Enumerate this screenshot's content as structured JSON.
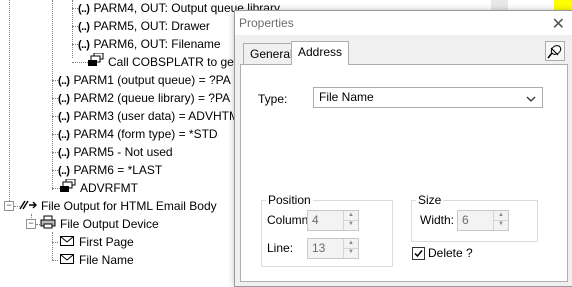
{
  "tree": {
    "rows": [
      {
        "kind": "param",
        "text": "PARM4, OUT: Output queue library"
      },
      {
        "kind": "param",
        "text": "PARM5, OUT: Drawer"
      },
      {
        "kind": "param",
        "text": "PARM6, OUT: Filename"
      },
      {
        "kind": "call",
        "text": "Call COBSPLATR to get qu"
      },
      {
        "kind": "param",
        "text": "PARM1 (output queue) =  ?PA"
      },
      {
        "kind": "param",
        "text": "PARM2 (queue library) =  ?PA"
      },
      {
        "kind": "param",
        "text": "PARM3 (user data) = ADVHTM"
      },
      {
        "kind": "param",
        "text": "PARM4 (form type) = *STD"
      },
      {
        "kind": "param",
        "text": "PARM5 - Not used"
      },
      {
        "kind": "param",
        "text": "PARM6 = *LAST"
      },
      {
        "kind": "call",
        "text": "ADVRFMT"
      },
      {
        "kind": "output",
        "text": "File Output for HTML Email Body"
      },
      {
        "kind": "device",
        "text": "File Output Device"
      },
      {
        "kind": "mail",
        "text": "First Page"
      },
      {
        "kind": "mail",
        "text": "File Name"
      }
    ],
    "param_glyph": "(..)",
    "expander_glyph": "−"
  },
  "dialog": {
    "title": "Properties",
    "close_glyph": "✕",
    "tabs": [
      "General",
      "Address"
    ],
    "active_tab": "Address",
    "type_label": "Type:",
    "type_value": "File Name",
    "position": {
      "title": "Position",
      "column_label": "Column:",
      "column_value": "4",
      "line_label": "Line:",
      "line_value": "13"
    },
    "size": {
      "title": "Size",
      "width_label": "Width:",
      "width_value": "6"
    },
    "delete_label": "Delete ?",
    "delete_checked": true
  },
  "colors": {
    "highlight_yellow": "#ffff00"
  }
}
